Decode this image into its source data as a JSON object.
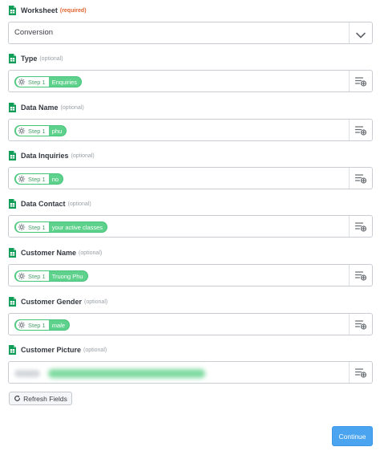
{
  "form": {
    "worksheet": {
      "label": "Worksheet",
      "hint": "(required)",
      "value": "Conversion"
    },
    "fields": [
      {
        "label": "Type",
        "hint": "(optional)",
        "step": "Step 1",
        "value": "Enquiries"
      },
      {
        "label": "Data Name",
        "hint": "(optional)",
        "step": "Step 1",
        "value": "phu"
      },
      {
        "label": "Data Inquiries",
        "hint": "(optional)",
        "step": "Step 1",
        "value": "no"
      },
      {
        "label": "Data Contact",
        "hint": "(optional)",
        "step": "Step 1",
        "value": "your active classes"
      },
      {
        "label": "Customer Name",
        "hint": "(optional)",
        "step": "Step 1",
        "value": "Truong Phu"
      },
      {
        "label": "Customer Gender",
        "hint": "(optional)",
        "step": "Step 1",
        "value": "male"
      },
      {
        "label": "Customer Picture",
        "hint": "(optional)"
      }
    ]
  },
  "actions": {
    "refresh_label": "Refresh Fields",
    "continue_label": "Continue"
  },
  "colors": {
    "pill_green": "#5ed18c",
    "required_orange": "#e0632e",
    "continue_blue": "#4aa4f0",
    "sheets_green": "#0f9d58"
  }
}
